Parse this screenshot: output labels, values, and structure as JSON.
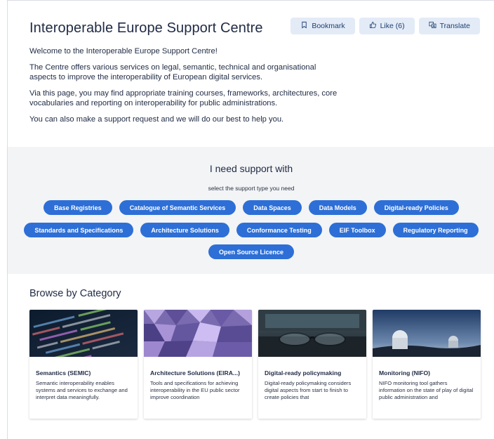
{
  "header": {
    "title": "Interoperable Europe Support Centre",
    "bookmark_label": "Bookmark",
    "like_label": "Like (6)",
    "translate_label": "Translate"
  },
  "intro": {
    "welcome": "Welcome to the Interoperable Europe Support Centre!",
    "p1": "The Centre offers various services on legal, semantic, technical and organisational aspects to improve the interoperability of European digital services.",
    "p2": "Via this page, you may find appropriate training courses, frameworks, architectures, core vocabularies and reporting on interoperability for public administrations.",
    "p3": "You can also make a support request and we will do our best to help you."
  },
  "support": {
    "title": "I need support with",
    "subtitle": "select the support type you need",
    "row1": [
      "Base Registries",
      "Catalogue of Semantic Services",
      "Data Spaces",
      "Data Models",
      "Digital-ready Policies"
    ],
    "row2": [
      "Standards and Specifications",
      "Architecture Solutions",
      "Conformance Testing",
      "EIF Toolbox",
      "Regulatory Reporting"
    ],
    "row3": [
      "Open Source Licence"
    ]
  },
  "browse": {
    "title": "Browse by Category",
    "cards": [
      {
        "title": "Semantics (SEMIC)",
        "text": "Semantic interoperability enables systems and services to exchange and interpret data meaningfully."
      },
      {
        "title": "Architecture Solutions (EIRA...)",
        "text": "Tools and specifications for achieving interoperability in the EU public sector improve coordination"
      },
      {
        "title": "Digital-ready policymaking",
        "text": "Digital-ready policymaking considers digital aspects from start to finish to create policies that"
      },
      {
        "title": "Monitoring (NIFO)",
        "text": "NIFO monitoring tool gathers information on the state of play of digital public administration and"
      }
    ]
  },
  "colors": {
    "accent": "#2d6fd6",
    "action_bg": "#e3ebf7",
    "support_bg": "#f3f4f6"
  }
}
